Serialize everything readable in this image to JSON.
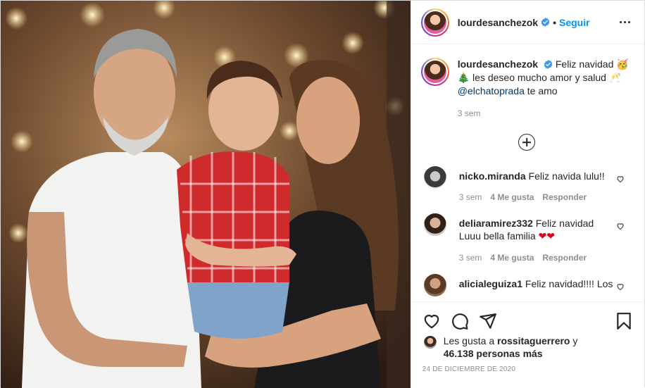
{
  "post": {
    "username": "lourdesanchezok",
    "follow_label": "Seguir",
    "separator": "•",
    "caption": {
      "username": "lourdesanchezok",
      "text_1": "Feliz navidad",
      "emoji_1": "🥳",
      "emoji_2": "🎄",
      "text_2": "les deseo mucho amor y salud",
      "emoji_3": "🥂",
      "mention": "@elchatoprada",
      "text_3": "te amo",
      "time": "3 sem"
    },
    "comments": [
      {
        "username": "nicko.miranda",
        "text": "Feliz navida lulu!!",
        "time": "3 sem",
        "likes": "4 Me gusta",
        "reply": "Responder",
        "avatar_color": "#d9d9d9"
      },
      {
        "username": "deliaramirez332",
        "text": "Feliz navidad Luuu bella familia",
        "hearts": "❤❤",
        "time": "3 sem",
        "likes": "4 Me gusta",
        "reply": "Responder",
        "avatar_color": "#a88f7a"
      },
      {
        "username": "alicialeguiza1",
        "text": "Feliz navidad!!!! Los",
        "avatar_color": "#6b4a34"
      }
    ],
    "likes": {
      "prefix": "Les gusta a",
      "user": "rossitaguerrero",
      "conj": "y",
      "count": "46.138 personas más"
    },
    "date": "24 DE DICIEMBRE DE 2020",
    "icons": [
      "heart-icon",
      "comment-icon",
      "share-icon",
      "bookmark-icon"
    ],
    "colors": {
      "accent": "#0095f6",
      "text": "#262626",
      "muted": "#8e8e8e",
      "mention": "#00376b"
    }
  }
}
